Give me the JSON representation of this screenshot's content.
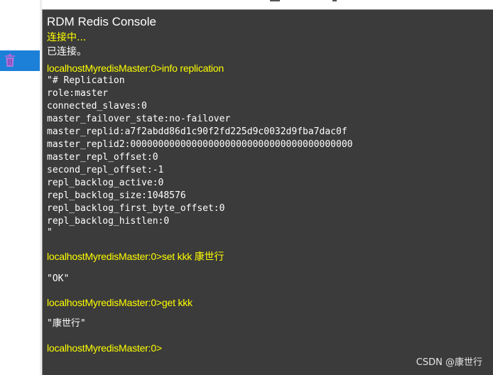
{
  "console": {
    "title": "RDM Redis Console",
    "connecting_text": "连接中...",
    "connected_text": "已连接。",
    "entries": [
      {
        "command": "localhostMyredisMaster:0>info replication",
        "output_lines": [
          "\"# Replication",
          "role:master",
          "connected_slaves:0",
          "master_failover_state:no-failover",
          "master_replid:a7f2abdd86d1c90f2fd225d9c0032d9fba7dac0f",
          "master_replid2:0000000000000000000000000000000000000000",
          "master_repl_offset:0",
          "second_repl_offset:-1",
          "repl_backlog_active:0",
          "repl_backlog_size:1048576",
          "repl_backlog_first_byte_offset:0",
          "repl_backlog_histlen:0",
          "\""
        ]
      },
      {
        "command": "localhostMyredisMaster:0>set kkk 康世行",
        "output_lines": [
          "\"OK\""
        ]
      },
      {
        "command": "localhostMyredisMaster:0>get kkk",
        "output_lines": [
          "\"康世行\""
        ]
      }
    ],
    "current_prompt": "localhostMyredisMaster:0>"
  },
  "sidebar": {
    "selected_icon": "trash-icon",
    "selected_color": "#1c7fd8"
  },
  "colors": {
    "console_background": "#3b3b3b",
    "prompt_color": "#ffff00",
    "output_color": "#ffffff"
  },
  "watermark": "CSDN @康世行"
}
